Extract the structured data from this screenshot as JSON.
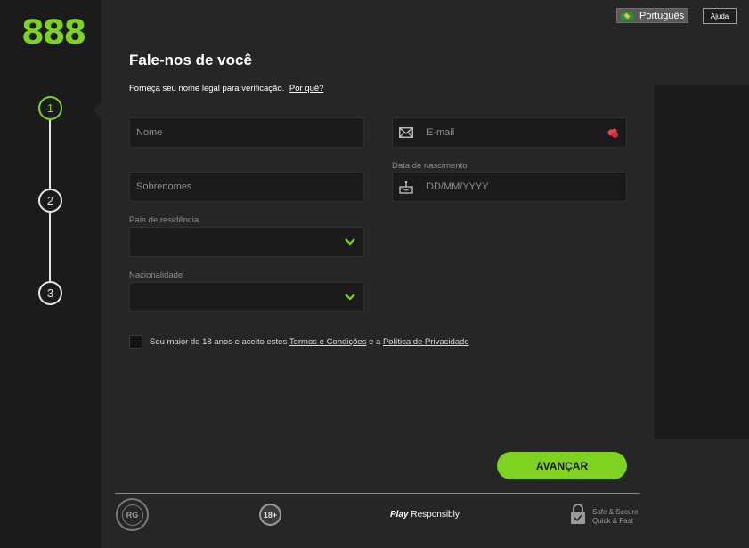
{
  "brand": {
    "logo_text": "888",
    "accent_color": "#7ed321"
  },
  "steps": [
    "1",
    "2",
    "3"
  ],
  "header": {
    "language_label": "Português",
    "help_label": "Ajuda"
  },
  "form": {
    "title": "Fale-nos de você",
    "subtitle": "Forneça seu nome legal para verificação.",
    "why_link": "Por quê?",
    "first_name_placeholder": "Nome",
    "last_name_placeholder": "Sobrenomes",
    "email_placeholder": "E-mail",
    "dob_label": "Data de nascimento",
    "dob_placeholder": "DD/MM/YYYY",
    "country_label": "País de residência",
    "nationality_label": "Nacionalidade",
    "terms_prefix": "Sou maior de 18 anos e aceito estes",
    "terms_link": "Termos e Condições",
    "terms_middle": "e a",
    "privacy_link": "Política de Privacidade",
    "submit_label": "AVANÇAR"
  },
  "footer": {
    "rg_label": "RG",
    "age_label": "18+",
    "play_label": "Play",
    "responsibly_label": "Responsibly",
    "secure_line1": "Safe & Secure",
    "secure_line2": "Quick & Fast"
  },
  "icons": {
    "email": "envelope-icon",
    "dob": "cake-icon",
    "select": "chevron-down-icon",
    "warning": "alert-icon",
    "secure": "lock-icon"
  }
}
